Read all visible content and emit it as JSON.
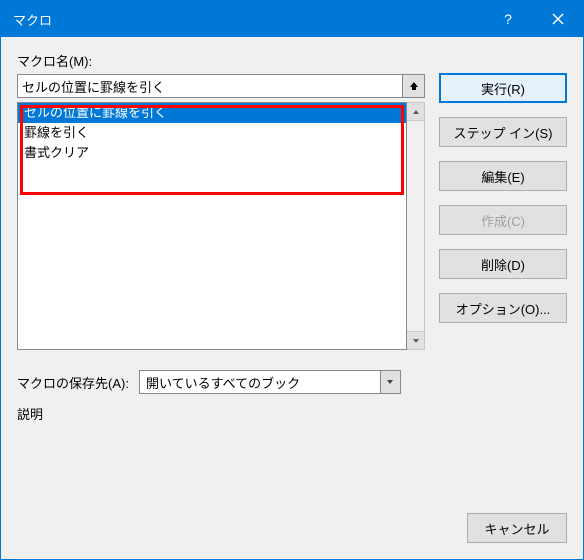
{
  "window": {
    "title": "マクロ"
  },
  "labels": {
    "macro_name": "マクロ名(M):",
    "store": "マクロの保存先(A):",
    "description": "説明"
  },
  "input": {
    "value": "セルの位置に罫線を引く"
  },
  "list": {
    "items": [
      "セルの位置に罫線を引く",
      "罫線を引く",
      "書式クリア"
    ],
    "selected_index": 0
  },
  "buttons": {
    "run": "実行(R)",
    "stepin": "ステップ イン(S)",
    "edit": "編集(E)",
    "create": "作成(C)",
    "delete": "削除(D)",
    "options": "オプション(O)...",
    "cancel": "キャンセル"
  },
  "combo": {
    "selected": "開いているすべてのブック"
  }
}
